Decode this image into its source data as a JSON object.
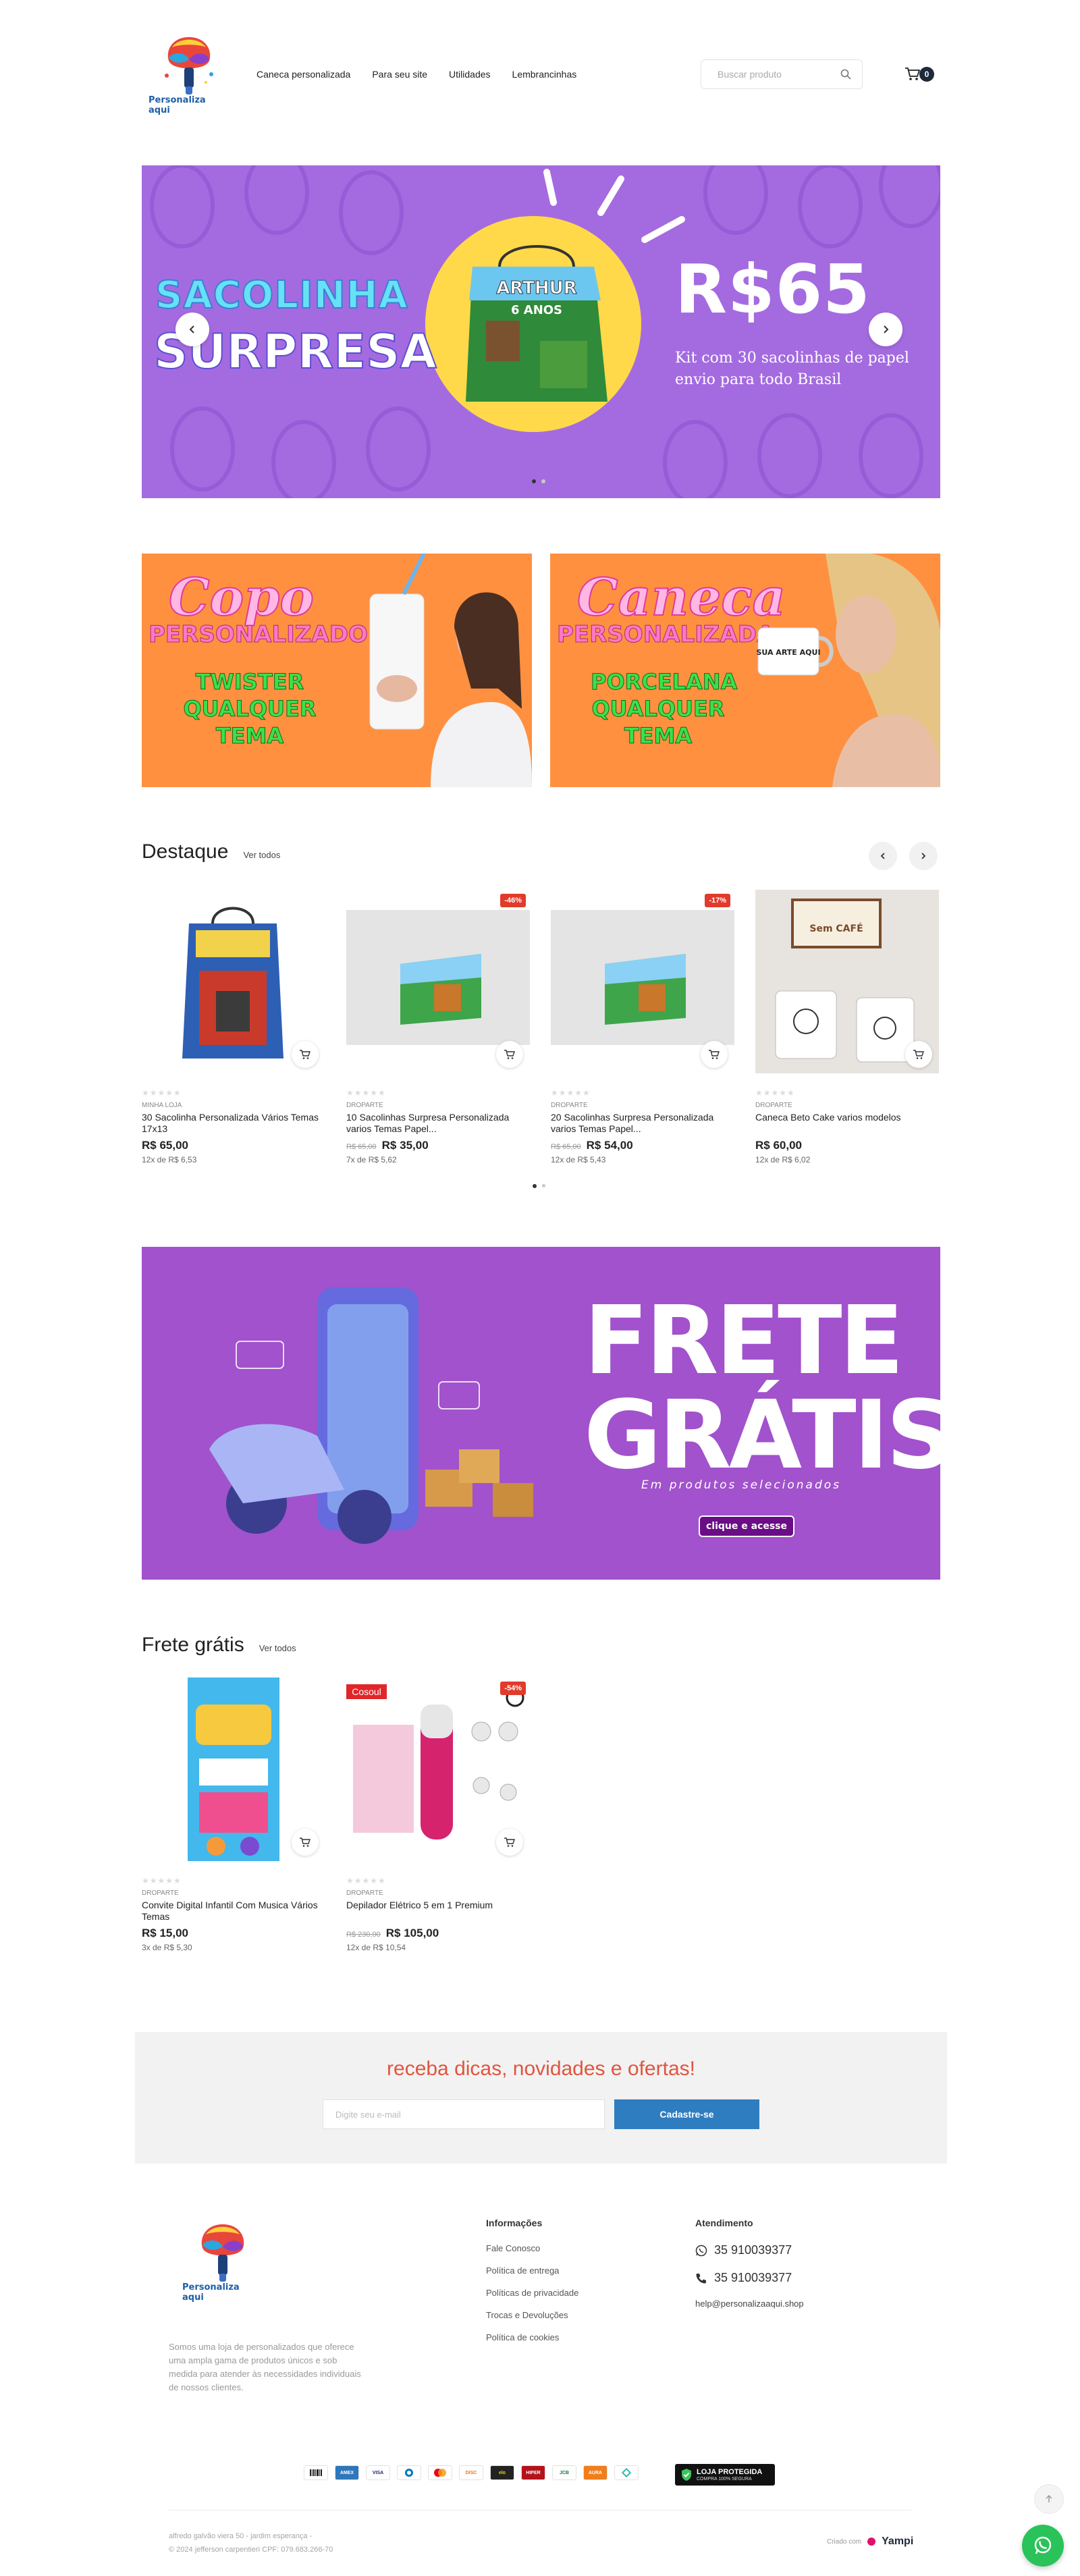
{
  "header": {
    "logo_text": "Personaliza aqui",
    "nav": [
      "Caneca personalizada",
      "Para seu site",
      "Utilidades",
      "Lembrancinhas"
    ],
    "search_placeholder": "Buscar produto",
    "cart_count": "0"
  },
  "hero": {
    "title_line1": "SACOLINHA",
    "title_line2": "SURPRESA",
    "bag_text_1": "ARTHUR",
    "bag_text_2": "6 ANOS",
    "price": "R$65",
    "subtitle_line1": "Kit com 30 sacolinhas de papel",
    "subtitle_line2": "envio para todo Brasil",
    "slide_index": 1,
    "slide_count": 2,
    "bg_color": "#a46be0"
  },
  "promos": [
    {
      "t1": "Copo",
      "t2": "PERSONALIZADO",
      "t3_lines": [
        "TWISTER",
        "QUALQUER",
        "TEMA"
      ]
    },
    {
      "t1": "Caneca",
      "t2": "PERSONALIZADA",
      "t3_lines": [
        "PORCELANA",
        "QUALQUER",
        "TEMA"
      ],
      "mug_text": "SUA ARTE AQUI"
    }
  ],
  "destaque": {
    "title": "Destaque",
    "see_all": "Ver todos",
    "products": [
      {
        "brand": "MINHA LOJA",
        "name": "30 Sacolinha Personalizada Vários Temas 17x13",
        "old_price": "",
        "price": "R$ 65,00",
        "installments": "12x de R$ 6,53",
        "discount": "",
        "rating": 0
      },
      {
        "brand": "DROPARTE",
        "name": "10 Sacolinhas Surpresa Personalizada varios Temas Papel...",
        "old_price": "R$ 65,00",
        "price": "R$ 35,00",
        "installments": "7x de R$ 5,62",
        "discount": "-46%",
        "rating": 0
      },
      {
        "brand": "DROPARTE",
        "name": "20 Sacolinhas Surpresa Personalizada varios Temas Papel...",
        "old_price": "R$ 65,00",
        "price": "R$ 54,00",
        "installments": "12x de R$ 5,43",
        "discount": "-17%",
        "rating": 0
      },
      {
        "brand": "DROPARTE",
        "name": "Caneca Beto Cake varios modelos",
        "old_price": "",
        "price": "R$ 60,00",
        "installments": "12x de R$ 6,02",
        "discount": "",
        "rating": 0,
        "sign_text": "Sem CAFÉ"
      }
    ]
  },
  "frete_banner": {
    "line1": "FRETE",
    "line2": "GRÁTIS",
    "subtitle": "Em produtos selecionados",
    "button": "clique e acesse"
  },
  "frete_gratis": {
    "title": "Frete grátis",
    "see_all": "Ver todos",
    "products": [
      {
        "brand": "DROPARTE",
        "name": "Convite Digital Infantil Com Musica Vários Temas",
        "old_price": "",
        "price": "R$ 15,00",
        "installments": "3x de R$ 5,30",
        "discount": "",
        "rating": 0
      },
      {
        "brand": "DROPARTE",
        "name": "Depilador Elétrico 5 em 1 Premium",
        "old_price": "R$ 230,00",
        "price": "R$ 105,00",
        "installments": "12x de R$ 10,54",
        "discount": "-54%",
        "rating": 0,
        "tag": "Cosoul"
      }
    ]
  },
  "newsletter": {
    "title": "receba dicas, novidades e ofertas!",
    "placeholder": "Digite seu e-mail",
    "button": "Cadastre-se"
  },
  "footer": {
    "logo_text": "Personaliza aqui",
    "about": "Somos uma loja de personalizados que oferece uma ampla gama de produtos únicos e sob medida para atender às necessidades individuais de nossos clientes.",
    "info_title": "Informações",
    "info_links": [
      "Fale Conosco",
      "Política de entrega",
      "Políticas de privacidade",
      "Trocas e Devoluções",
      "Política de cookies"
    ],
    "support_title": "Atendimento",
    "whatsapp": "35 910039377",
    "phone": "35 910039377",
    "email": "help@personalizaaqui.shop",
    "payments": [
      "boleto",
      "amex",
      "visa",
      "diners",
      "mastercard",
      "discover",
      "elo",
      "hipercard",
      "jcb",
      "aura",
      "pix"
    ],
    "secure_title": "LOJA PROTEGIDA",
    "secure_sub": "COMPRA 100% SEGURA",
    "address_1": "alfredo galvão viera 50 - jardim esperança -",
    "address_2": "© 2024 jefferson carpentieri CPF: 079.683.266-70",
    "made_with": "Criado com",
    "platform": "Yampi"
  }
}
